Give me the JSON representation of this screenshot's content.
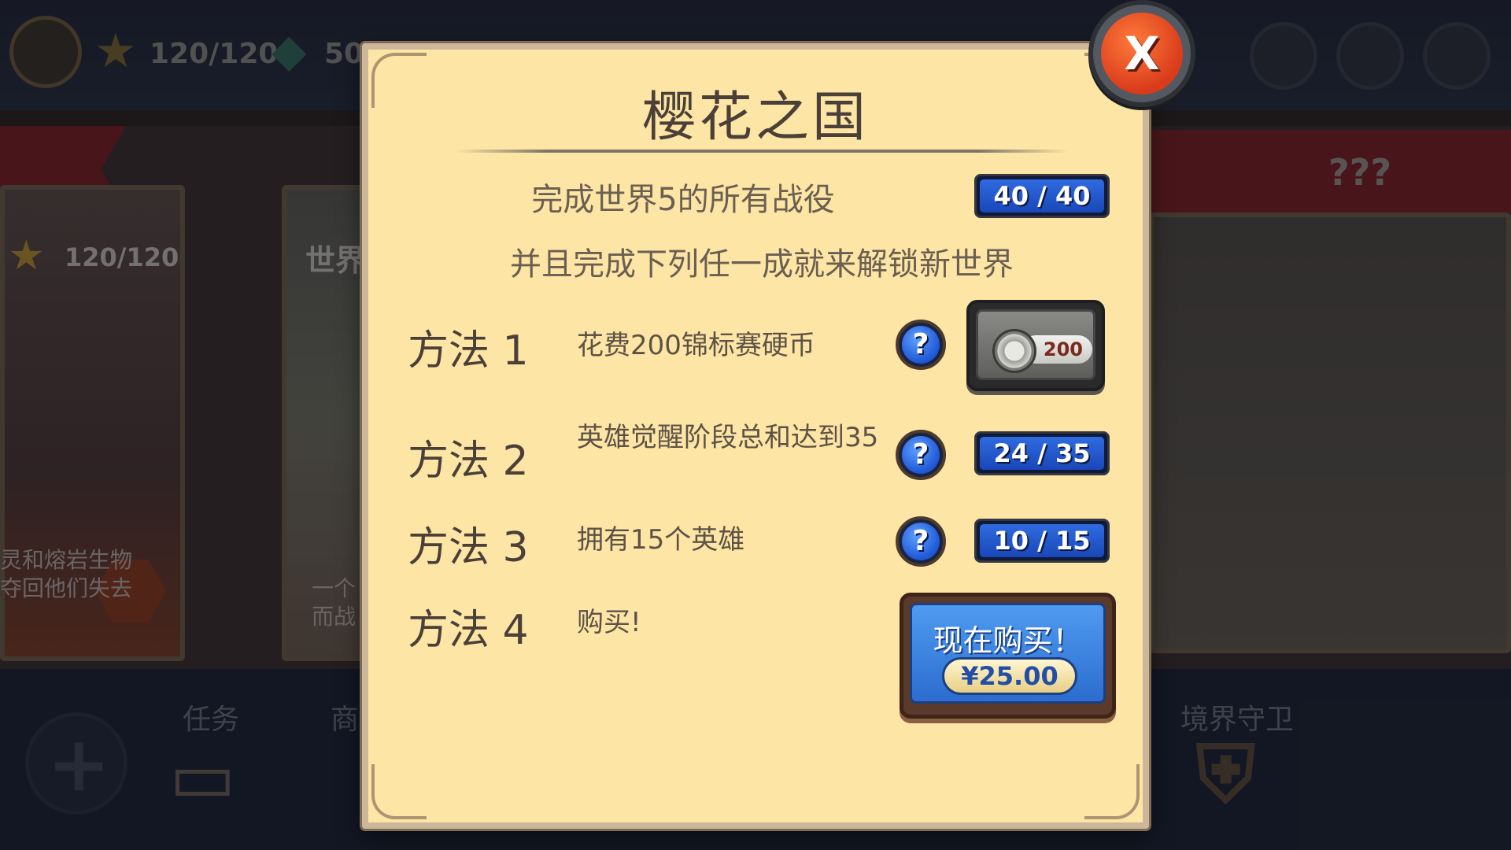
{
  "background": {
    "stars": "120/120",
    "gems": "50",
    "card_stars": "120/120",
    "card_world_label": "世界",
    "locked_label": "???",
    "desc_line1": "灵和熔岩生物",
    "desc_line2": "夺回他们失去",
    "desc_b_line1": "一个",
    "desc_b_line2": "而战",
    "tab_tasks": "任务",
    "tab_shop": "商",
    "tab_realm": "境界守卫"
  },
  "modal": {
    "title": "樱花之国",
    "requirement": "完成世界5的所有战役",
    "requirement_progress": "40 / 40",
    "instruction": "并且完成下列任一成就来解锁新世界",
    "methods": [
      {
        "label": "方法 1",
        "desc": "花费200锦标赛硬币",
        "coin_cost": "200"
      },
      {
        "label": "方法 2",
        "desc": "英雄觉醒阶段总和达到35",
        "progress": "24 / 35"
      },
      {
        "label": "方法 3",
        "desc": "拥有15个英雄",
        "progress": "10 / 15"
      },
      {
        "label": "方法 4",
        "desc": "购买!",
        "buy_label": "现在购买！",
        "price": "¥25.00"
      }
    ],
    "help_symbol": "?",
    "close_label": "X"
  },
  "colors": {
    "panel": "#fde5a6",
    "counter_blue": "#2f6be0",
    "close_red": "#d93b1b"
  }
}
